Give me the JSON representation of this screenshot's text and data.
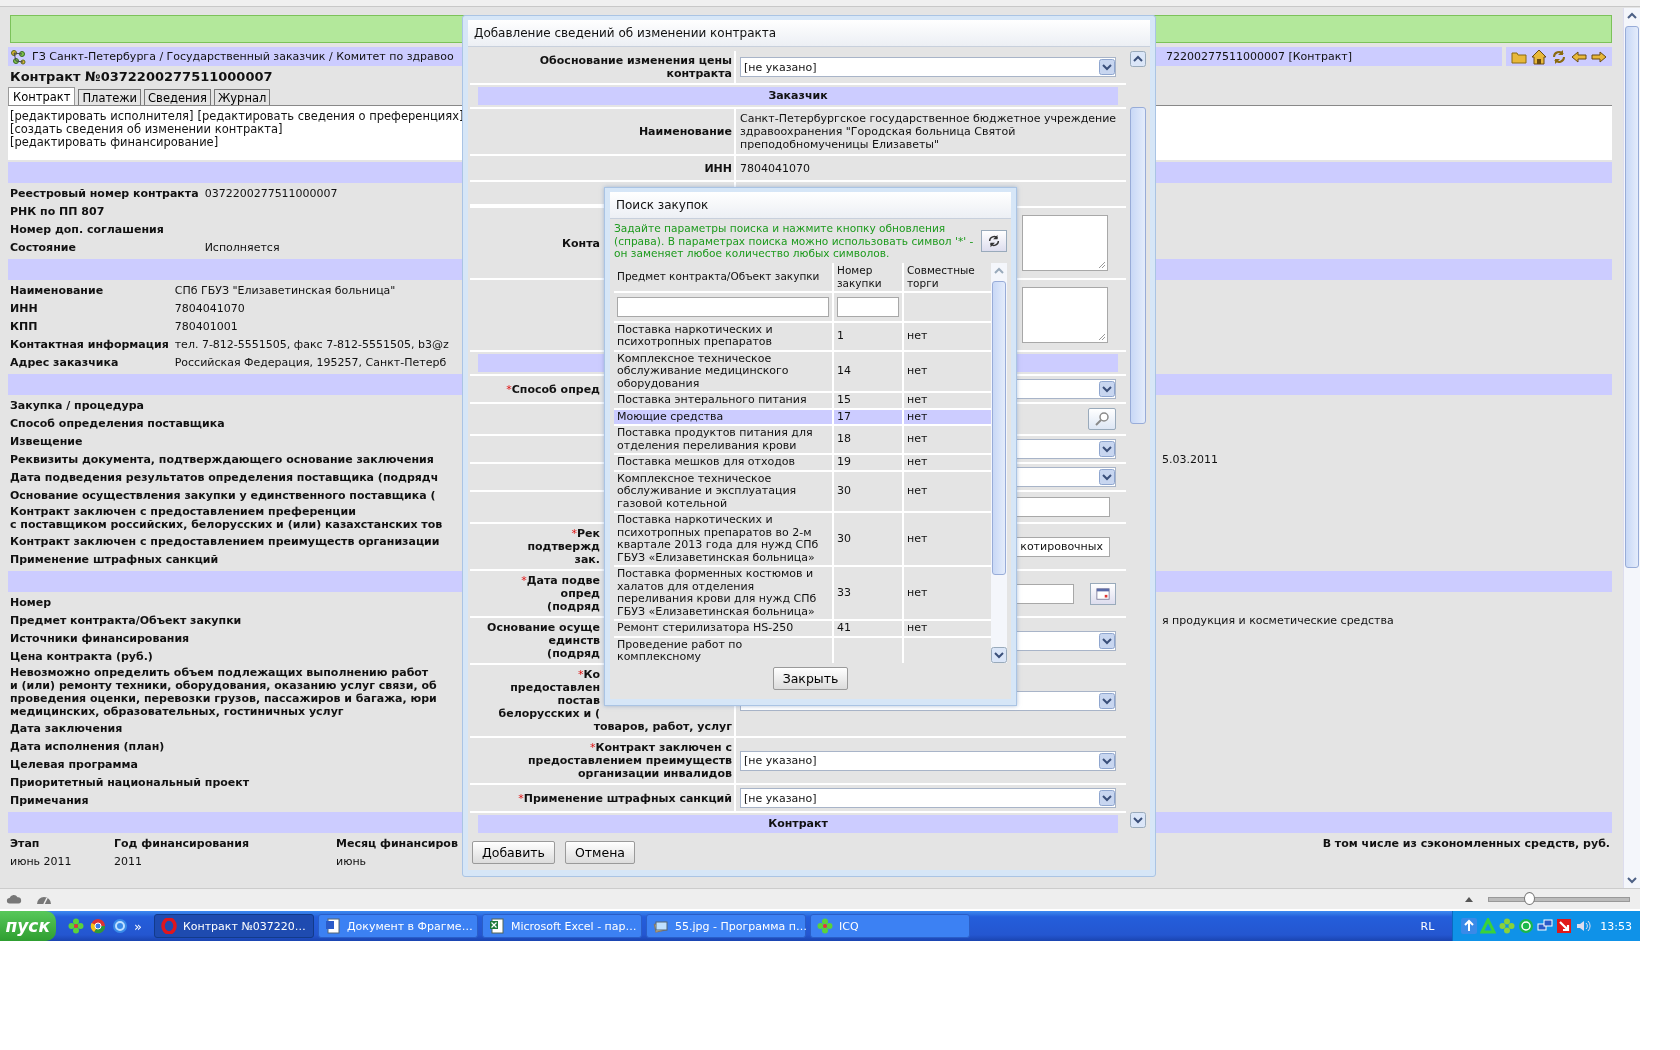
{
  "browser_page": {
    "breadcrumb": {
      "path": "ГЗ Санкт-Петербурга / Государственный заказчик / Комитет по здравоо",
      "tail": "72200277511000007 [Контракт]"
    },
    "title": "Контракт №0372200277511000007",
    "tabs": [
      {
        "label": "Контракт",
        "selected": true
      },
      {
        "label": "Платежи",
        "selected": false
      },
      {
        "label": "Сведения",
        "selected": false
      },
      {
        "label": "Журнал",
        "selected": false
      }
    ],
    "links": [
      [
        "[редактировать исполнителя]",
        "[редактировать сведения о преференциях]"
      ],
      [
        "[создать сведения об изменении контракта]"
      ],
      [
        "[редактировать финансирование]"
      ]
    ],
    "sections": [
      {
        "rows": [
          {
            "label": [
              "Реестровый номер контракта"
            ],
            "value": "0372200277511000007"
          },
          {
            "label": [
              "РНК по ПП 807"
            ]
          },
          {
            "label": [
              "Номер доп. соглашения"
            ]
          },
          {
            "label": [
              "Состояние"
            ],
            "value": "Исполняется"
          }
        ]
      },
      {
        "rows": [
          {
            "label": [
              "Наименование"
            ],
            "value": "СПб ГБУЗ \"Елизаветинская больница\""
          },
          {
            "label": [
              "ИНН"
            ],
            "value": "7804041070"
          },
          {
            "label": [
              "КПП"
            ],
            "value": "780401001"
          },
          {
            "label": [
              "Контактная информация"
            ],
            "value": "тел. 7-812-5551505, факс 7-812-5551505, b3@z"
          },
          {
            "label": [
              "Адрес заказчика"
            ],
            "value": "Российская Федерация, 195257, Санкт-Петерб"
          }
        ]
      },
      {
        "rows": [
          {
            "label": [
              "Закупка / процедура"
            ]
          },
          {
            "label": [
              "Способ определения поставщика"
            ]
          },
          {
            "label": [
              "Извещение"
            ]
          },
          {
            "label": [
              "Реквизиты документа, подтверждающего основание заключения"
            ],
            "tail": "5.03.2011"
          },
          {
            "label": [
              "Дата подведения результатов определения поставщика (подрядч"
            ]
          },
          {
            "label": [
              "Основание осуществления закупки у единственного поставщика ("
            ]
          },
          {
            "label": [
              "Контракт заключен с предоставлением преференции",
              "с поставщиком российских, белорусских и (или) казахстанских тов"
            ]
          },
          {
            "label": [
              "Контракт заключен с предоставлением преимуществ организации"
            ]
          },
          {
            "label": [
              "Применение штрафных санкций"
            ]
          }
        ]
      },
      {
        "rows": [
          {
            "label": [
              "Номер"
            ]
          },
          {
            "label": [
              "Предмет контракта/Объект закупки"
            ],
            "tail": "я продукция и косметические средства"
          },
          {
            "label": [
              "Источники финансирования"
            ]
          },
          {
            "label": [
              "Цена контракта (руб.)"
            ]
          },
          {
            "label": [
              "Невозможно определить объем подлежащих выполнению работ",
              "и (или) ремонту техники, оборудования, оказанию услуг связи, об",
              "проведения оценки, перевозки грузов, пассажиров и багажа, юри",
              "медицинских, образовательных, гостиничных услуг"
            ]
          },
          {
            "label": [
              "Дата заключения"
            ]
          },
          {
            "label": [
              "Дата исполнения (план)"
            ]
          },
          {
            "label": [
              "Целевая программа"
            ]
          },
          {
            "label": [
              "Приоритетный национальный проект"
            ]
          },
          {
            "label": [
              "Примечания"
            ]
          }
        ]
      }
    ],
    "finance_table": {
      "columns": [
        "Этап",
        "Год финансирования",
        "Месяц финансиров"
      ],
      "tail_column": "В том числе из сэкономленных средств, руб.",
      "rows": [
        [
          "июнь 2011",
          "2011",
          "июнь"
        ]
      ]
    }
  },
  "dialog": {
    "title": "Добавление сведений об изменении контракта",
    "rows": [
      {
        "kind": "select",
        "label": [
          {
            "text": "Обоснование изменения цены"
          },
          {
            "text": "контракта"
          }
        ],
        "value": "[не указано]"
      },
      {
        "kind": "section",
        "title": "Заказчик"
      },
      {
        "kind": "text",
        "label": [
          {
            "text": "Наименование"
          }
        ],
        "value": "Санкт-Петербургское государственное бюджетное учреждение здравоохранения \"Городская больница Святой преподобномученицы Елизаветы\""
      },
      {
        "kind": "text",
        "label": [
          {
            "text": "ИНН"
          }
        ],
        "value": "7804041070"
      },
      {
        "kind": "blank"
      },
      {
        "kind": "textarea",
        "label": [
          {
            "text": "Конта",
            "covered": true
          }
        ]
      },
      {
        "kind": "textarea"
      },
      {
        "kind": "section"
      },
      {
        "kind": "select",
        "mark": "*",
        "label": [
          {
            "text": "Способ опред",
            "covered": true
          }
        ]
      },
      {
        "kind": "search"
      },
      {
        "kind": "select"
      },
      {
        "kind": "select"
      },
      {
        "kind": "input"
      },
      {
        "kind": "input",
        "mark": "*",
        "label": [
          {
            "text": "Рек",
            "covered": true
          },
          {
            "text": "подтвержд",
            "covered": true
          },
          {
            "text": "зак.",
            "covered": true
          }
        ],
        "value": "котировочных"
      },
      {
        "kind": "date",
        "mark": "*",
        "label": [
          {
            "text": "Дата подве",
            "covered": true
          },
          {
            "text": "опред",
            "covered": true
          },
          {
            "text": "(подряд",
            "covered": true
          }
        ]
      },
      {
        "kind": "select",
        "label": [
          {
            "text": "Основание осуще",
            "covered": true
          },
          {
            "text": "единств",
            "covered": true
          },
          {
            "text": "(подряд",
            "covered": true
          }
        ]
      },
      {
        "kind": "select",
        "mark": "*",
        "label": [
          {
            "text": "Ко",
            "covered": true
          },
          {
            "text": "предоставлен",
            "covered": true
          },
          {
            "text": "постав",
            "covered": true
          },
          {
            "text": "белорусских и (",
            "covered": true
          },
          {
            "text": "товаров, работ, услуг",
            "covered": false
          }
        ]
      },
      {
        "kind": "select",
        "mark": "*",
        "label": [
          {
            "text": "Контракт заключен с"
          },
          {
            "text": "предоставлением преимуществ"
          },
          {
            "text": "организации инвалидов"
          }
        ],
        "value": "[не указано]"
      },
      {
        "kind": "select",
        "mark": "*",
        "label": [
          {
            "text": "Применение штрафных санкций"
          }
        ],
        "value": "[не указано]"
      },
      {
        "kind": "section",
        "title": "Контракт"
      }
    ],
    "buttons": [
      "Добавить",
      "Отмена"
    ]
  },
  "search_popup": {
    "title": "Поиск закупок",
    "hint": "Задайте параметры поиска и нажмите кнопку обновления (справа). В параметрах поиска можно использовать символ '*' - он заменяет любое количество любых символов.",
    "columns": [
      "Предмет контракта/Объект закупки",
      "Номер закупки",
      "Совместные торги"
    ],
    "rows": [
      {
        "subject": "Поставка наркотических и психотропных препаратов",
        "number": "1",
        "joint": "нет",
        "selected": false
      },
      {
        "subject": "Комплексное техническое обслуживание медицинского оборудования",
        "number": "14",
        "joint": "нет",
        "selected": false
      },
      {
        "subject": "Поставка энтерального питания",
        "number": "15",
        "joint": "нет",
        "selected": false
      },
      {
        "subject": "Моющие средства",
        "number": "17",
        "joint": "нет",
        "selected": true
      },
      {
        "subject": "Поставка продуктов питания для отделения переливания крови",
        "number": "18",
        "joint": "нет",
        "selected": false
      },
      {
        "subject": "Поставка мешков для отходов",
        "number": "19",
        "joint": "нет",
        "selected": false
      },
      {
        "subject": "Комплексное техническое обслуживание и эксплуатация газовой котельной",
        "number": "30",
        "joint": "нет",
        "selected": false
      },
      {
        "subject": "Поставка наркотических и психотропных препаратов во 2-м квартале 2013 года для нужд СПб ГБУЗ «Елизаветинская больница»",
        "number": "30",
        "joint": "нет",
        "selected": false
      },
      {
        "subject": "Поставка форменных костюмов и халатов для отделения переливания крови для нужд СПб ГБУЗ «Елизаветинская больница»",
        "number": "33",
        "joint": "нет",
        "selected": false
      },
      {
        "subject": "Ремонт стерилизатора HS-250",
        "number": "41",
        "joint": "нет",
        "selected": false
      },
      {
        "subject": "Проведение работ по комплексному",
        "selected": false
      }
    ],
    "close_button": "Закрыть"
  },
  "status_bar": {
    "zoom_slider": {
      "level": 0.29
    }
  },
  "taskbar": {
    "start": "пуск",
    "quick_launch_more": "»",
    "tasks": [
      {
        "kind": "opera",
        "label": "Контракт №037220…",
        "selected": true
      },
      {
        "kind": "word",
        "label": "Документ в Фрагме…",
        "selected": false
      },
      {
        "kind": "excel",
        "label": "Microsoft Excel - пар…",
        "selected": false
      },
      {
        "kind": "viewer",
        "label": "55.jpg - Программа п…",
        "selected": false
      },
      {
        "kind": "icq",
        "label": "ICQ",
        "selected": false
      }
    ],
    "language": "RL",
    "clock": "13:53"
  }
}
